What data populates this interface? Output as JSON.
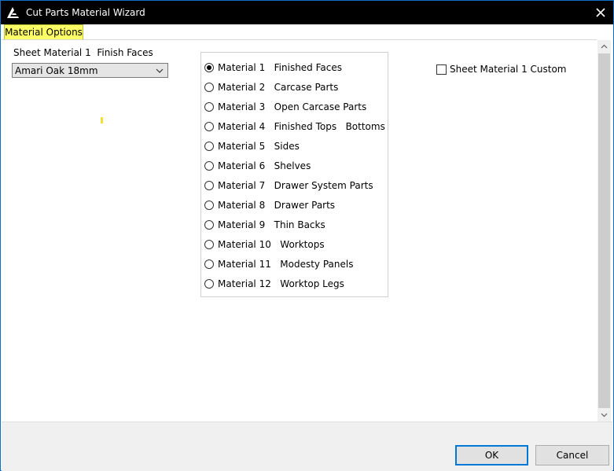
{
  "window": {
    "title": "Cut Parts Material Wizard",
    "logo_icon": "app-logo-icon",
    "close_icon": "close-icon"
  },
  "tabs": [
    {
      "label": "Material Options",
      "active": true,
      "color": "#ffff66"
    }
  ],
  "left_panel": {
    "heading": "Sheet Material 1  Finish Faces",
    "combo_value": "Amari Oak 18mm"
  },
  "materials": [
    {
      "label": "Material 1   Finished Faces",
      "checked": true
    },
    {
      "label": "Material 2   Carcase Parts",
      "checked": false
    },
    {
      "label": "Material 3   Open Carcase Parts",
      "checked": false
    },
    {
      "label": "Material 4   Finished Tops   Bottoms",
      "checked": false
    },
    {
      "label": "Material 5   Sides",
      "checked": false
    },
    {
      "label": "Material 6   Shelves",
      "checked": false
    },
    {
      "label": "Material 7   Drawer System Parts",
      "checked": false
    },
    {
      "label": "Material 8   Drawer Parts",
      "checked": false
    },
    {
      "label": "Material 9   Thin Backs",
      "checked": false
    },
    {
      "label": "Material 10   Worktops",
      "checked": false
    },
    {
      "label": "Material 11   Modesty Panels",
      "checked": false
    },
    {
      "label": "Material 12   Worktop Legs",
      "checked": false
    }
  ],
  "custom_checkbox": {
    "label": "Sheet Material 1 Custom",
    "checked": false
  },
  "footer": {
    "ok_label": "OK",
    "cancel_label": "Cancel"
  },
  "colors": {
    "titlebar": "#000000",
    "window_border": "#0f6fc6",
    "tab_active": "#ffff66",
    "default_button_border": "#0078d7"
  }
}
